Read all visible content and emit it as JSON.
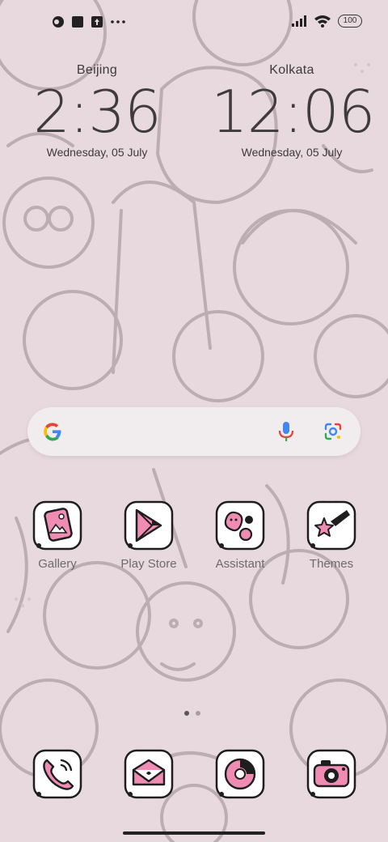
{
  "status_bar": {
    "left_icons": [
      "app-notification-icon",
      "square-notification-icon",
      "upload-notification-icon",
      "more-dots-icon"
    ],
    "right_icons": [
      "signal-icon",
      "wifi-icon"
    ],
    "battery": "100"
  },
  "clocks": [
    {
      "city": "Beijing",
      "time": "2:36",
      "date": "Wednesday, 05 July"
    },
    {
      "city": "Kolkata",
      "time": "12:06",
      "date": "Wednesday, 05 July"
    }
  ],
  "search": {
    "icons": [
      "google-g-icon",
      "microphone-icon",
      "google-lens-icon"
    ]
  },
  "apps": [
    {
      "label": "Gallery",
      "icon": "gallery-icon"
    },
    {
      "label": "Play Store",
      "icon": "play-store-icon"
    },
    {
      "label": "Assistant",
      "icon": "assistant-icon"
    },
    {
      "label": "Themes",
      "icon": "themes-icon"
    }
  ],
  "dock": [
    "phone-icon",
    "messages-icon",
    "browser-icon",
    "camera-icon"
  ],
  "page_indicator": {
    "count": 2,
    "active": 1
  },
  "colors": {
    "wallpaper": "#e7d9dd",
    "line_art": "#b8a9ae",
    "accent_pink": "#f08cb4",
    "icon_outline": "#1e1e1e"
  }
}
